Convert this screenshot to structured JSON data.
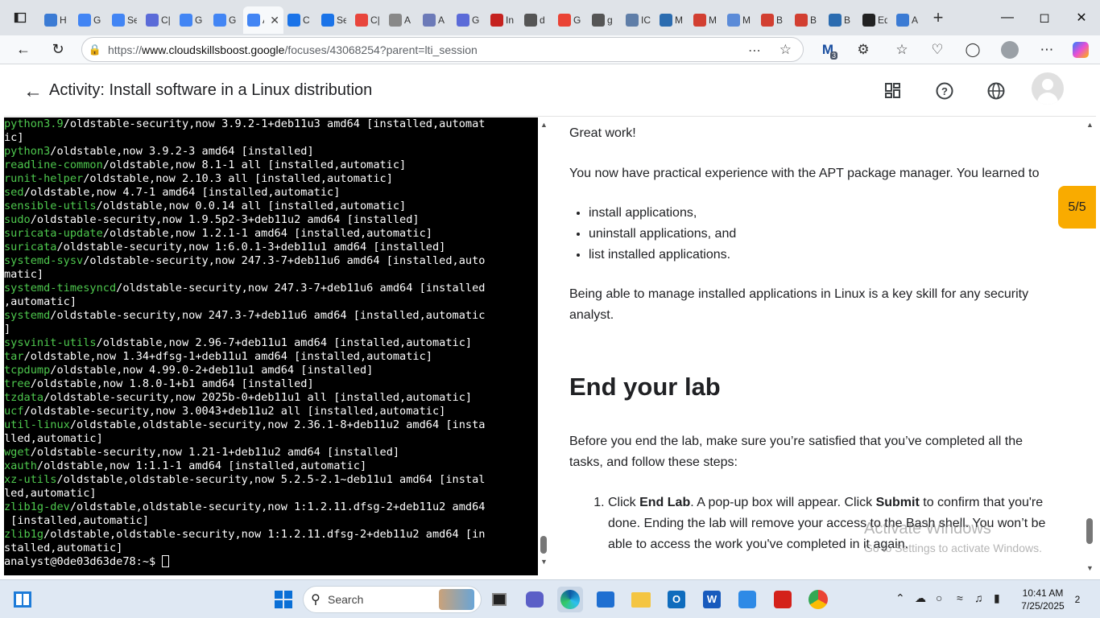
{
  "browser": {
    "tabs": [
      {
        "label": "H",
        "color": "#3b7bd4"
      },
      {
        "label": "G",
        "color": "#4285f4"
      },
      {
        "label": "Se",
        "color": "#4285f4"
      },
      {
        "label": "C|",
        "color": "#5b6bd8"
      },
      {
        "label": "G",
        "color": "#4285f4"
      },
      {
        "label": "G",
        "color": "#4285f4"
      },
      {
        "label": "A",
        "color": "#4285f4",
        "active": true
      },
      {
        "label": "C",
        "color": "#1a73e8"
      },
      {
        "label": "Se",
        "color": "#1a73e8"
      },
      {
        "label": "C|",
        "color": "#e8453c"
      },
      {
        "label": "A",
        "color": "#888888"
      },
      {
        "label": "A",
        "color": "#6c7ab8"
      },
      {
        "label": "G",
        "color": "#5b6bd8"
      },
      {
        "label": "In",
        "color": "#c5221f"
      },
      {
        "label": "d",
        "color": "#555555"
      },
      {
        "label": "G",
        "color": "#ea4335"
      },
      {
        "label": "g",
        "color": "#555555"
      },
      {
        "label": "IC",
        "color": "#5f7ea8"
      },
      {
        "label": "M",
        "color": "#2b6cb0"
      },
      {
        "label": "M",
        "color": "#d23f31"
      },
      {
        "label": "M",
        "color": "#5b8bd8"
      },
      {
        "label": "B",
        "color": "#d23f31"
      },
      {
        "label": "B",
        "color": "#d23f31"
      },
      {
        "label": "B",
        "color": "#2b6cb0"
      },
      {
        "label": "Ed",
        "color": "#222222"
      },
      {
        "label": "A",
        "color": "#3b7bd4"
      }
    ],
    "url_prefix": "https://",
    "url_host": "www.cloudskillsboost.google",
    "url_path": "/focuses/43068254?parent=lti_session",
    "ext_badge": "3"
  },
  "header": {
    "title": "Activity: Install software in a Linux distribution"
  },
  "terminal": {
    "lines": [
      {
        "pkg": "python3.9",
        "rest": "/oldstable-security,now 3.9.2-1+deb11u3 amd64 [installed,automat"
      },
      {
        "pkg": "",
        "rest": "ic]"
      },
      {
        "pkg": "python3",
        "rest": "/oldstable,now 3.9.2-3 amd64 [installed]"
      },
      {
        "pkg": "readline-common",
        "rest": "/oldstable,now 8.1-1 all [installed,automatic]"
      },
      {
        "pkg": "runit-helper",
        "rest": "/oldstable,now 2.10.3 all [installed,automatic]"
      },
      {
        "pkg": "sed",
        "rest": "/oldstable,now 4.7-1 amd64 [installed,automatic]"
      },
      {
        "pkg": "sensible-utils",
        "rest": "/oldstable,now 0.0.14 all [installed,automatic]"
      },
      {
        "pkg": "sudo",
        "rest": "/oldstable-security,now 1.9.5p2-3+deb11u2 amd64 [installed]"
      },
      {
        "pkg": "suricata-update",
        "rest": "/oldstable,now 1.2.1-1 amd64 [installed,automatic]"
      },
      {
        "pkg": "suricata",
        "rest": "/oldstable-security,now 1:6.0.1-3+deb11u1 amd64 [installed]"
      },
      {
        "pkg": "systemd-sysv",
        "rest": "/oldstable-security,now 247.3-7+deb11u6 amd64 [installed,auto"
      },
      {
        "pkg": "",
        "rest": "matic]"
      },
      {
        "pkg": "systemd-timesyncd",
        "rest": "/oldstable-security,now 247.3-7+deb11u6 amd64 [installed"
      },
      {
        "pkg": "",
        "rest": ",automatic]"
      },
      {
        "pkg": "systemd",
        "rest": "/oldstable-security,now 247.3-7+deb11u6 amd64 [installed,automatic"
      },
      {
        "pkg": "",
        "rest": "]"
      },
      {
        "pkg": "sysvinit-utils",
        "rest": "/oldstable,now 2.96-7+deb11u1 amd64 [installed,automatic]"
      },
      {
        "pkg": "tar",
        "rest": "/oldstable,now 1.34+dfsg-1+deb11u1 amd64 [installed,automatic]"
      },
      {
        "pkg": "tcpdump",
        "rest": "/oldstable,now 4.99.0-2+deb11u1 amd64 [installed]"
      },
      {
        "pkg": "tree",
        "rest": "/oldstable,now 1.8.0-1+b1 amd64 [installed]"
      },
      {
        "pkg": "tzdata",
        "rest": "/oldstable-security,now 2025b-0+deb11u1 all [installed,automatic]"
      },
      {
        "pkg": "ucf",
        "rest": "/oldstable-security,now 3.0043+deb11u2 all [installed,automatic]"
      },
      {
        "pkg": "util-linux",
        "rest": "/oldstable,oldstable-security,now 2.36.1-8+deb11u2 amd64 [insta"
      },
      {
        "pkg": "",
        "rest": "lled,automatic]"
      },
      {
        "pkg": "wget",
        "rest": "/oldstable-security,now 1.21-1+deb11u2 amd64 [installed]"
      },
      {
        "pkg": "xauth",
        "rest": "/oldstable,now 1:1.1-1 amd64 [installed,automatic]"
      },
      {
        "pkg": "xz-utils",
        "rest": "/oldstable,oldstable-security,now 5.2.5-2.1~deb11u1 amd64 [instal"
      },
      {
        "pkg": "",
        "rest": "led,automatic]"
      },
      {
        "pkg": "zlib1g-dev",
        "rest": "/oldstable,oldstable-security,now 1:1.2.11.dfsg-2+deb11u2 amd64"
      },
      {
        "pkg": "",
        "rest": " [installed,automatic]"
      },
      {
        "pkg": "zlib1g",
        "rest": "/oldstable,oldstable-security,now 1:1.2.11.dfsg-2+deb11u2 amd64 [in"
      },
      {
        "pkg": "",
        "rest": "stalled,automatic]"
      }
    ],
    "prompt": "analyst@0de03d63de78:~$ "
  },
  "instructions": {
    "great_work": "Great work!",
    "intro": "You now have practical experience with the APT package manager. You learned to",
    "bullets": [
      "install applications,",
      "uninstall applications, and",
      "list installed applications."
    ],
    "summary": "Being able to manage installed applications in Linux is a key skill for any security analyst.",
    "end_heading": "End your lab",
    "end_intro": "Before you end the lab, make sure you’re satisfied that you’ve completed all the tasks, and follow these steps:",
    "step1_a": "Click ",
    "step1_b": "End Lab",
    "step1_c": ". A pop-up box will appear. Click ",
    "step1_d": "Submit",
    "step1_e": " to confirm that you're done. Ending the lab will remove your access to the Bash shell. You won’t be able to access the work you've completed in it again.",
    "progress": "5/5"
  },
  "watermark": {
    "line1": "Activate Windows",
    "line2": "Go to Settings to activate Windows."
  },
  "taskbar": {
    "search_label": "Search",
    "time": "10:41 AM",
    "date": "7/25/2025",
    "notifications": "2"
  }
}
